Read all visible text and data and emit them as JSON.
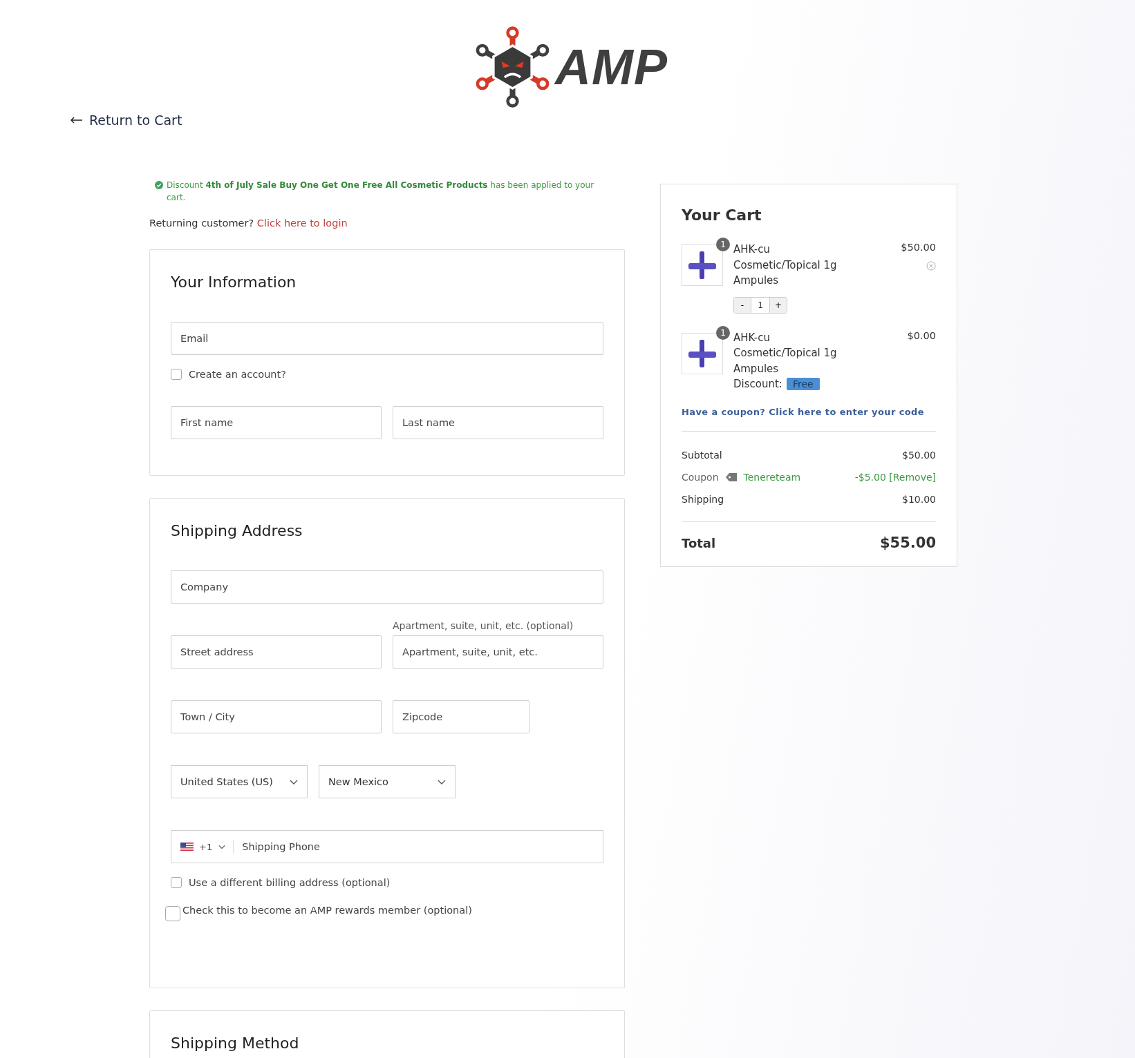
{
  "logo": {
    "text": "AMP"
  },
  "back_link": {
    "label": "Return to Cart"
  },
  "notice": {
    "text": "Discount **4th of July Sale Buy One Get One Free All Cosmetic Products** has been applied to your cart."
  },
  "returning": {
    "text": "Returning customer?",
    "link": "Click here to login"
  },
  "sections": [
    {
      "title": "Your Information",
      "rows": [
        {
          "kind": "single",
          "items": [
            {
              "kind": "input",
              "placeholder": "Email"
            }
          ]
        },
        {
          "kind": "check",
          "items": [
            {
              "kind": "checkbox",
              "label": "Create an account?",
              "checked": false
            }
          ]
        },
        {
          "kind": "pair",
          "items": [
            {
              "kind": "input",
              "placeholder": "First name"
            },
            {
              "kind": "input",
              "placeholder": "Last name"
            }
          ]
        }
      ]
    },
    {
      "title": "Shipping Address",
      "rows": [
        {
          "kind": "single",
          "items": [
            {
              "kind": "input",
              "placeholder": "Company"
            }
          ]
        },
        {
          "kind": "pair",
          "items": [
            {
              "kind": "input",
              "placeholder": "Street address"
            },
            {
              "kind": "input",
              "label": "Apartment, suite, unit, etc. (optional)",
              "placeholder": "Apartment, suite, unit, etc."
            }
          ]
        },
        {
          "kind": "city",
          "items": [
            {
              "kind": "input",
              "placeholder": "Town / City"
            },
            {
              "kind": "input",
              "placeholder": "Zipcode"
            }
          ]
        },
        {
          "kind": "selects",
          "items": [
            {
              "kind": "select",
              "value": "United States (US)"
            },
            {
              "kind": "select",
              "value": "New Mexico"
            }
          ]
        },
        {
          "kind": "single",
          "items": [
            {
              "kind": "phone",
              "code": "+1",
              "placeholder": "Shipping Phone"
            }
          ]
        },
        {
          "kind": "check",
          "items": [
            {
              "kind": "checkbox",
              "label": "Use a different billing address (optional)",
              "checked": false
            }
          ]
        },
        {
          "kind": "check-large",
          "items": [
            {
              "kind": "checkbox",
              "label": "Check this to become an AMP rewards member (optional)",
              "checked": false
            }
          ]
        }
      ]
    },
    {
      "title": "Shipping Method"
    }
  ],
  "cart": {
    "title": "Your Cart",
    "items": [
      {
        "quantity_badge": "1",
        "name": "AHK-cu Cosmetic/Topical 1g Ampules",
        "price": "$50.00",
        "removable": true,
        "stepper": {
          "minus": "-",
          "value": "1",
          "plus": "+"
        }
      },
      {
        "quantity_badge": "1",
        "name": "AHK-cu Cosmetic/Topical 1g Ampules",
        "price": "$0.00",
        "removable": false,
        "discount": {
          "label": "Discount:",
          "tag": "Free"
        }
      }
    ],
    "coupon_link": "Have a coupon? Click here to enter your code",
    "totals": [
      {
        "kind": "plain",
        "label": "Subtotal",
        "value": "$50.00"
      },
      {
        "kind": "coupon",
        "label": "Coupon",
        "code": "Tenereteam",
        "value": "-$5.00 [Remove]"
      },
      {
        "kind": "plain",
        "label": "Shipping",
        "value": "$10.00"
      }
    ],
    "total": {
      "label": "Total",
      "value": "$55.00"
    }
  }
}
